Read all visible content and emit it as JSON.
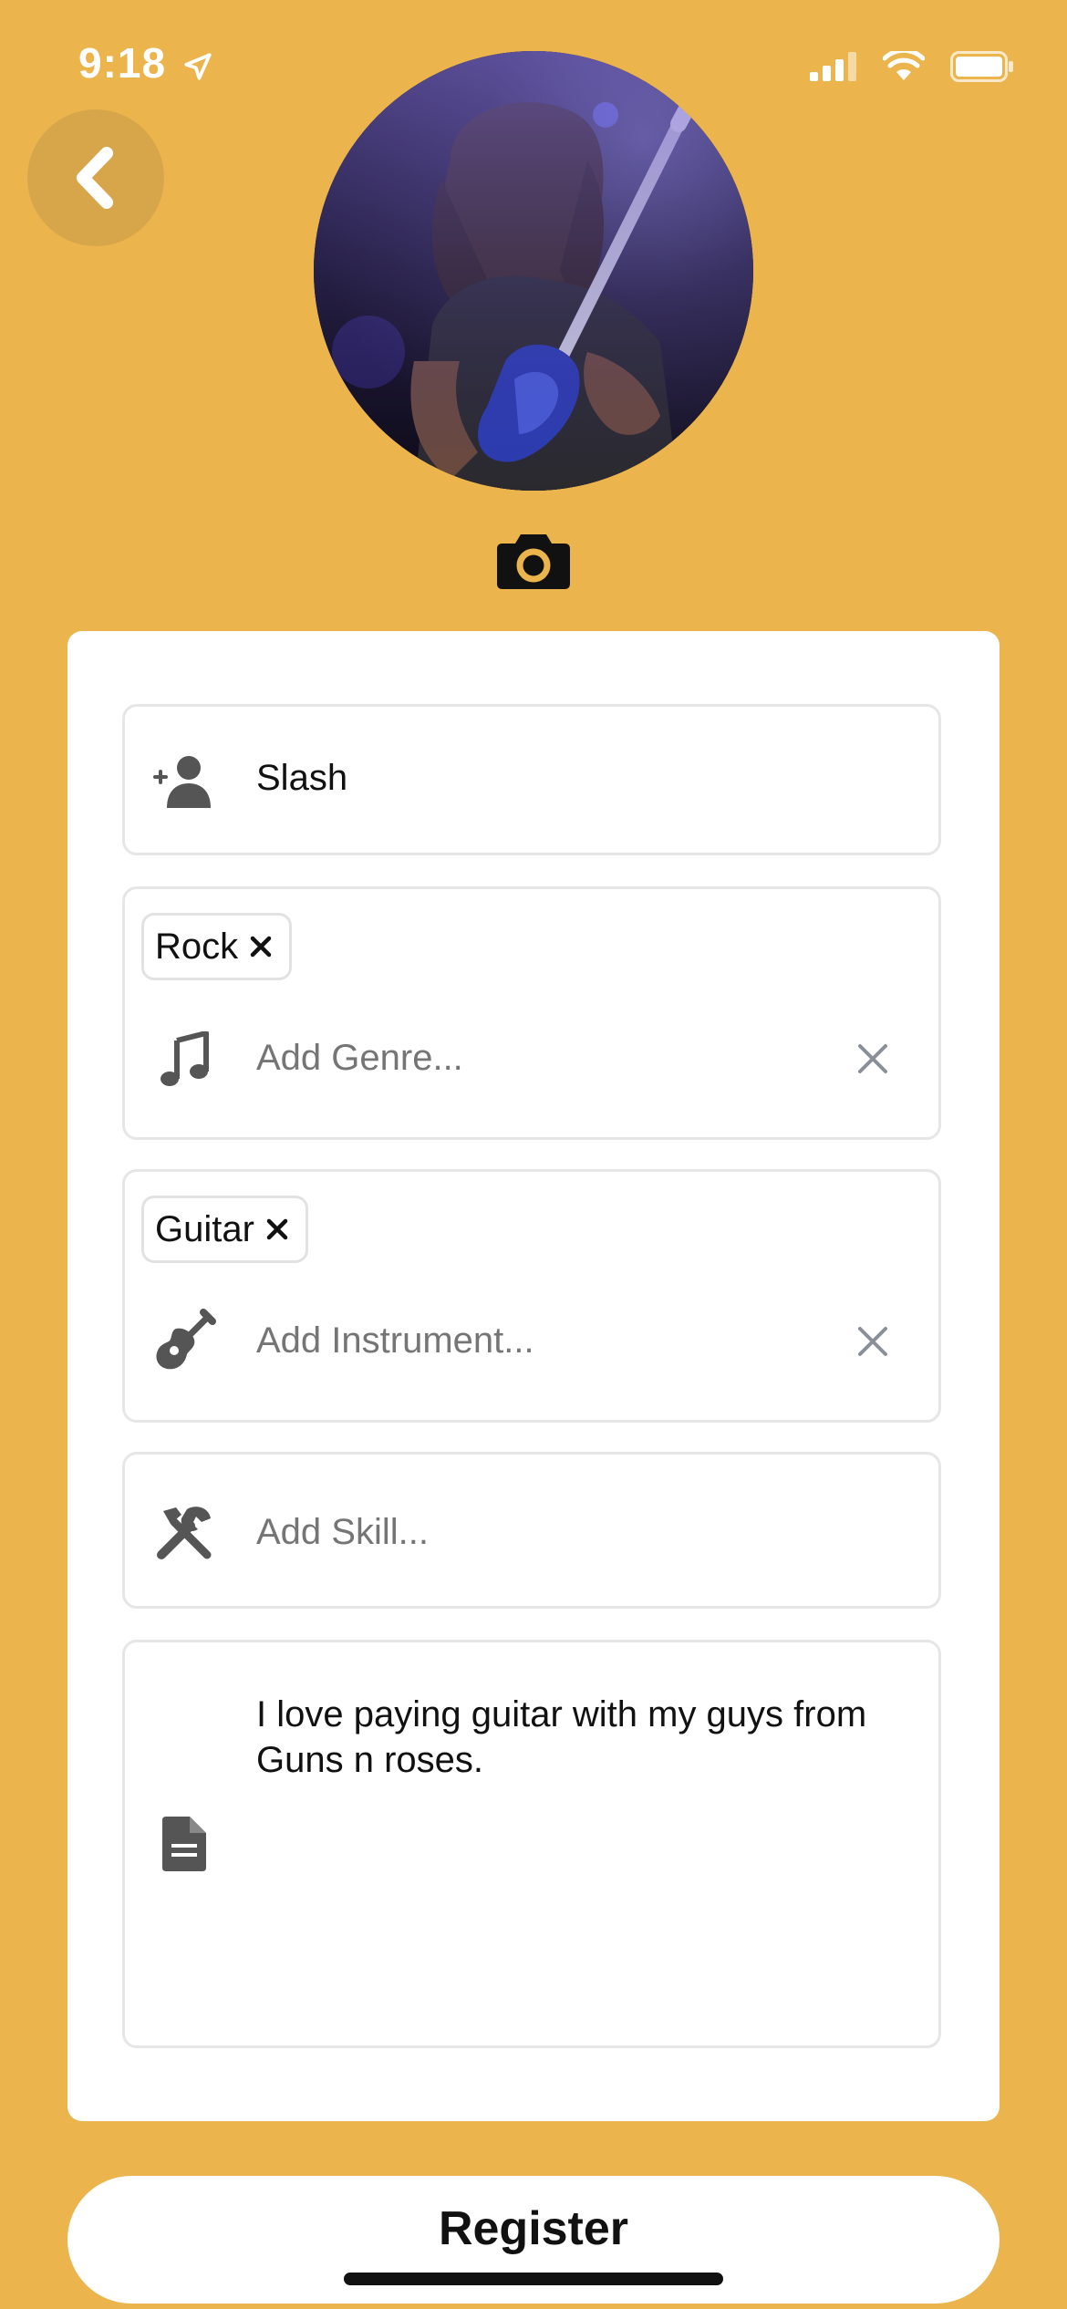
{
  "status_bar": {
    "time": "9:18"
  },
  "profile": {
    "name": "Slash",
    "genre": {
      "tags": [
        "Rock"
      ],
      "placeholder": "Add Genre..."
    },
    "instrument": {
      "tags": [
        "Guitar"
      ],
      "placeholder": "Add Instrument..."
    },
    "skill": {
      "placeholder": "Add Skill..."
    },
    "bio": "I love paying guitar with my guys from Guns n roses."
  },
  "actions": {
    "register_label": "Register"
  },
  "colors": {
    "background": "#ebb44c",
    "card": "#ffffff",
    "icon": "#555555",
    "placeholder": "#c4c4c4"
  }
}
